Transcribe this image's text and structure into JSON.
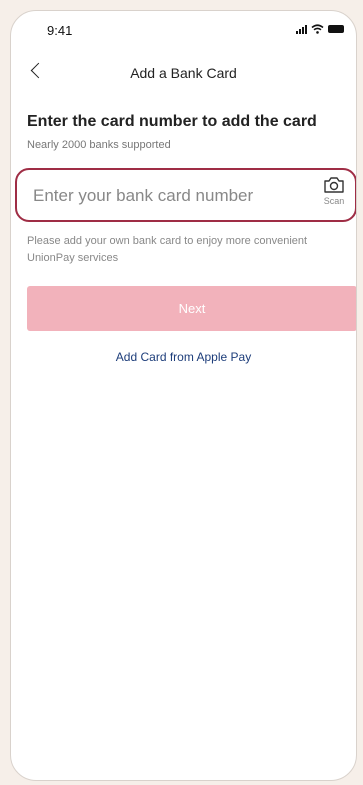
{
  "status_bar": {
    "time": "9:41"
  },
  "nav": {
    "title": "Add a Bank Card"
  },
  "content": {
    "heading": "Enter the card number to add the card",
    "subheading": "Nearly 2000 banks supported",
    "card_input": {
      "value": "",
      "placeholder": "Enter your bank card number"
    },
    "scan_label": "Scan",
    "note": "Please add your own bank card to enjoy more convenient UnionPay services",
    "next_label": "Next",
    "apple_pay_label": "Add Card from Apple Pay"
  },
  "icons": {
    "back": "back-chevron-icon",
    "camera": "camera-icon",
    "signal": "signal-icon",
    "wifi": "wifi-icon",
    "battery": "battery-icon"
  },
  "colors": {
    "input_border": "#9f2d45",
    "next_button_bg": "#f2b2bb",
    "next_button_text": "#ffffff",
    "link": "#1d3d7a",
    "page_background": "#f6efe9"
  }
}
